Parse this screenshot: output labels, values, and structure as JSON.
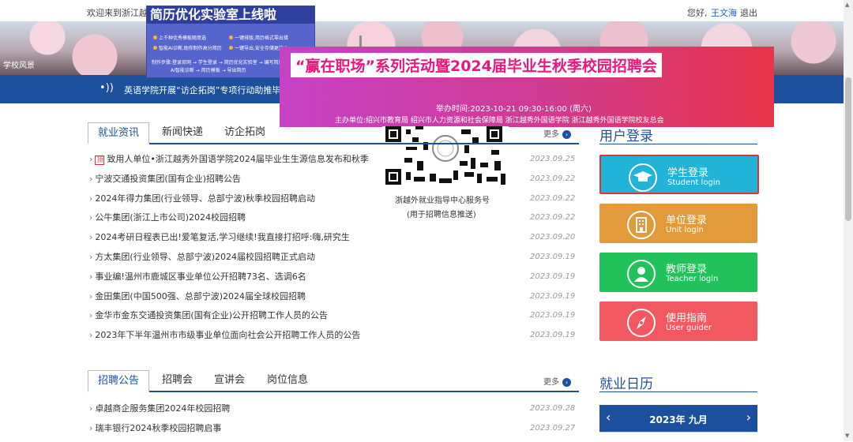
{
  "topbar": {
    "welcome": "欢迎来到浙江越秀",
    "hello": "您好,",
    "user": "王文海",
    "logout": "退出"
  },
  "hero": {
    "caption": "学校风景"
  },
  "ticker": {
    "text": "英语学院开展“访企拓岗”专项行动助推毕业"
  },
  "popup_small": {
    "title": "简历优化实验室上线啦",
    "lines": [
      "上千种优秀模板随意选",
      "一键排版,简历格式零出错",
      "智能AI诊断,助你制作高分简历",
      "一键导出,安全存储更放心"
    ],
    "footer1": "制作步骤:登录官网 → 学生登录 → 简历优化实验室 → 编写简历",
    "footer2": "AI智能诊断 → 简历模板 → 导出简历"
  },
  "popup_banner": {
    "title": "“赢在职场”系列活动暨2024届毕业生秋季校园招聘会",
    "time": "举办时间:2023-10-21 09:30-16:00 (周六)",
    "host": "主办单位:绍兴市教育局 绍兴市人力资源和社会保障局 浙江越秀外国语学院 浙江越秀外国语学院校友总会"
  },
  "qr": {
    "caption1": "浙越外就业指导中心服务号",
    "caption2": "(用于招聘信息推送)"
  },
  "news": {
    "tabs": [
      "就业资讯",
      "新闻快递",
      "访企拓岗"
    ],
    "more": "更多",
    "items": [
      {
        "badge": "顶",
        "title": "致用人单位•浙江越秀外国语学院2024届毕业生生源信息发布和秋季",
        "date": "2023.09.25"
      },
      {
        "title": "宁波交通投资集团(国有企业)招聘公告",
        "date": "2023.09.22"
      },
      {
        "title": "2024年得力集团(行业领导、总部宁波)秋季校园招聘启动",
        "date": "2023.09.22"
      },
      {
        "title": "公牛集团(浙江上市公司)2024校园招聘",
        "date": "2023.09.22"
      },
      {
        "title": "2024考研日程表已出!爱笔复活,学习继续!我直接打招呼:嗨,研究生",
        "date": "2023.09.20"
      },
      {
        "title": "方太集团(行业领导、总部宁波)2024届校园招聘正式启动",
        "date": "2023.09.19"
      },
      {
        "title": "事业编!温州市鹿城区事业单位公开招聘73名、选调6名",
        "date": "2023.09.19"
      },
      {
        "title": "金田集团(中国500强、总部宁波)2024届全球校园招聘",
        "date": "2023.09.19"
      },
      {
        "title": "金华市金东交通投资集团(国有企业)公开招聘工作人员的公告",
        "date": "2023.09.19"
      },
      {
        "title": "2023年下半年温州市市级事业单位面向社会公开招聘工作人员的公告",
        "date": "2023.09.19"
      }
    ]
  },
  "recruit": {
    "tabs": [
      "招聘公告",
      "招聘会",
      "宣讲会",
      "岗位信息"
    ],
    "more": "更多",
    "items": [
      {
        "title": "卓越商企服务集团2024年校园招聘",
        "date": "2023.09.28"
      },
      {
        "title": "瑞丰银行2024秋季校园招聘启事",
        "date": "2023.09.27"
      }
    ]
  },
  "login": {
    "title": "用户登录",
    "buttons": [
      {
        "label": "学生登录",
        "sub": "Student login",
        "color": "#22b3d8",
        "icon": "graduation-cap-icon"
      },
      {
        "label": "单位登录",
        "sub": "Unit login",
        "color": "#e39a3b",
        "icon": "building-icon"
      },
      {
        "label": "教师登录",
        "sub": "Teacher login",
        "color": "#22c25a",
        "icon": "person-icon"
      },
      {
        "label": "使用指南",
        "sub": "User guider",
        "color": "#f2585f",
        "icon": "compass-icon"
      }
    ]
  },
  "calendar": {
    "title": "就业日历",
    "month": "2023年 九月",
    "prev": "‹",
    "next": "›"
  }
}
